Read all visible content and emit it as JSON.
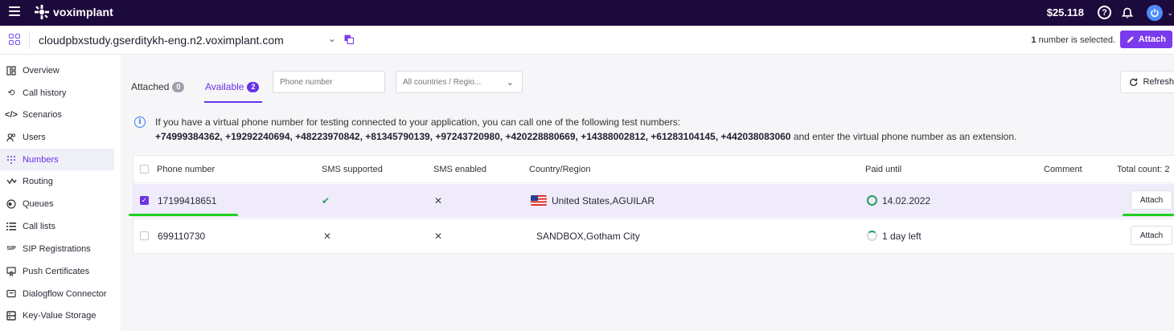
{
  "topbar": {
    "brand": "voximplant",
    "balance": "$25.118",
    "help_glyph": "?"
  },
  "appbar": {
    "app_name": "cloudpbxstudy.gserditykh-eng.n2.voximplant.com",
    "selection_count": "1",
    "selection_text": "number is selected.",
    "attach_label": "Attach"
  },
  "sidebar": {
    "items": [
      {
        "label": "Overview",
        "icon": "overview-icon"
      },
      {
        "label": "Call history",
        "icon": "history-icon"
      },
      {
        "label": "Scenarios",
        "icon": "code-icon"
      },
      {
        "label": "Users",
        "icon": "users-icon"
      },
      {
        "label": "Numbers",
        "icon": "dialpad-icon",
        "active": true
      },
      {
        "label": "Routing",
        "icon": "routing-icon"
      },
      {
        "label": "Queues",
        "icon": "queue-icon"
      },
      {
        "label": "Call lists",
        "icon": "list-icon"
      },
      {
        "label": "SIP Registrations",
        "icon": "sip-icon"
      },
      {
        "label": "Push Certificates",
        "icon": "certificate-icon"
      },
      {
        "label": "Dialogflow Connector",
        "icon": "dialog-icon"
      },
      {
        "label": "Key-Value Storage",
        "icon": "storage-icon"
      }
    ],
    "sip_glyph": "SIP"
  },
  "tabs": {
    "attached_label": "Attached",
    "attached_count": "0",
    "available_label": "Available",
    "available_count": "2"
  },
  "filters": {
    "phone_placeholder": "Phone number",
    "country_value": "All countries / Regio..."
  },
  "refresh_label": "Refresh",
  "info": {
    "line1": "If you have a virtual phone number for testing connected to your application, you can call one of the following test numbers:",
    "numbers": "+74999384362, +19292240694, +48223970842, +81345790139, +97243720980, +420228880669, +14388002812, +61283104145, +442038083060",
    "suffix": " and enter the virtual phone number as an extension."
  },
  "table": {
    "headers": {
      "phone": "Phone number",
      "sms_supported": "SMS supported",
      "sms_enabled": "SMS enabled",
      "country": "Country/Region",
      "paid_until": "Paid until",
      "comment": "Comment",
      "total": "Total count: 2"
    },
    "rows": [
      {
        "phone": "17199418651",
        "sms_supported": "✔",
        "sms_enabled": "✕",
        "country": "United States,AGUILAR",
        "paid_until": "14.02.2022",
        "action": "Attach",
        "selected": true
      },
      {
        "phone": "699110730",
        "sms_supported": "✕",
        "sms_enabled": "✕",
        "country": "SANDBOX,Gotham City",
        "paid_until": "1 day left",
        "action": "Attach",
        "selected": false
      }
    ]
  },
  "colors": {
    "topbar": "#1d0a3d",
    "accent": "#6a32e6",
    "highlight_underline": "#1fd01f",
    "paid_ok": "#22a05c"
  }
}
